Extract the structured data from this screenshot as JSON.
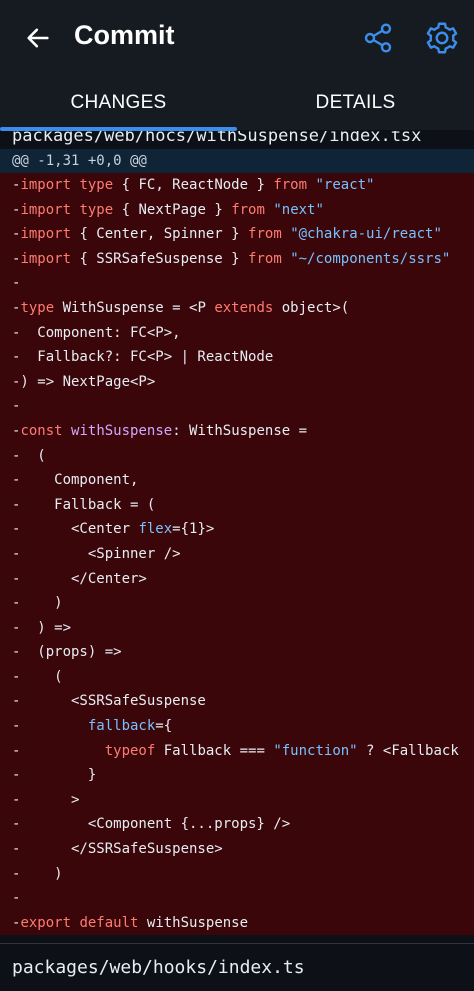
{
  "appbar": {
    "title": "Commit",
    "back_icon": "arrow-left-icon",
    "share_icon": "share-icon",
    "settings_icon": "gear-icon",
    "accent": "#3b8eea"
  },
  "tabs": [
    {
      "label": "CHANGES",
      "selected": true
    },
    {
      "label": "DETAILS",
      "selected": false
    }
  ],
  "files": [
    {
      "path": "packages/web/hocs/withSuspense/index.tsx",
      "hunk": "@@ -1,31 +0,0 @@"
    },
    {
      "path": "packages/web/hooks/index.ts"
    }
  ],
  "diff_lines": [
    "-import type { FC, ReactNode } from \"react\"",
    "-import type { NextPage } from \"next\"",
    "-import { Center, Spinner } from \"@chakra-ui/react\"",
    "-import { SSRSafeSuspense } from \"~/components/ssrs\"",
    "-",
    "-type WithSuspense = <P extends object>(",
    "-  Component: FC<P>,",
    "-  Fallback?: FC<P> | ReactNode",
    "-) => NextPage<P>",
    "-",
    "-const withSuspense: WithSuspense =",
    "-  (",
    "-    Component,",
    "-    Fallback = (",
    "-      <Center flex={1}>",
    "-        <Spinner />",
    "-      </Center>",
    "-    )",
    "-  ) =>",
    "-  (props) =>",
    "-    (",
    "-      <SSRSafeSuspense",
    "-        fallback={",
    "-          typeof Fallback === \"function\" ? <Fallback",
    "-        }",
    "-      >",
    "-        <Component {...props} />",
    "-      </SSRSafeSuspense>",
    "-    )",
    "-",
    "-export default withSuspense"
  ]
}
